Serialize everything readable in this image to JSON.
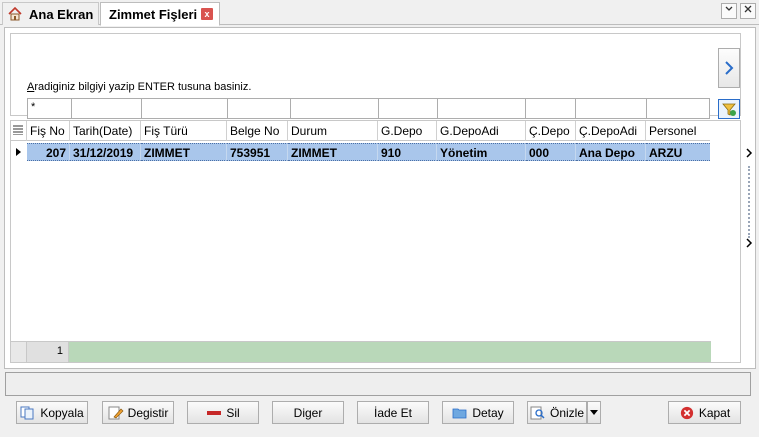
{
  "tabs": {
    "home_label": "Ana Ekran",
    "active_label": "Zimmet Fişleri",
    "close_glyph": "x"
  },
  "window_controls": {
    "dropdown_glyph": "⌄",
    "close_glyph": "✕"
  },
  "search": {
    "hint_prefix": "A",
    "hint_rest": "radiginiz bilgiyi yazip ENTER tusuna basiniz.",
    "filter_value": "*"
  },
  "grid": {
    "columns": [
      "Fiş No",
      "Tarih(Date)",
      "Fiş Türü",
      "Belge No",
      "Durum",
      "G.Depo",
      "G.DepoAdi",
      "Ç.Depo",
      "Ç.DepoAdi",
      "Personel"
    ],
    "rows": [
      {
        "fis_no": "207",
        "tarih": "31/12/2019",
        "fis_turu": "ZIMMET",
        "belge_no": "753951",
        "durum": "ZIMMET",
        "g_depo": "910",
        "g_depo_adi": "Yönetim",
        "c_depo": "000",
        "c_depo_adi": "Ana Depo",
        "personel": "ARZU"
      }
    ],
    "record_count": "1"
  },
  "buttons": {
    "kopyala": "Kopyala",
    "degistir": "Degistir",
    "sil": "Sil",
    "diger": "Diger",
    "iade_et": "İade Et",
    "detay": "Detay",
    "onizle": "Önizle",
    "kapat": "Kapat"
  },
  "colors": {
    "selected_row": "#a9c6eb",
    "footer_fill": "#b9d8b9",
    "accent_blue": "#2a6dc9",
    "close_red": "#d9534f"
  }
}
